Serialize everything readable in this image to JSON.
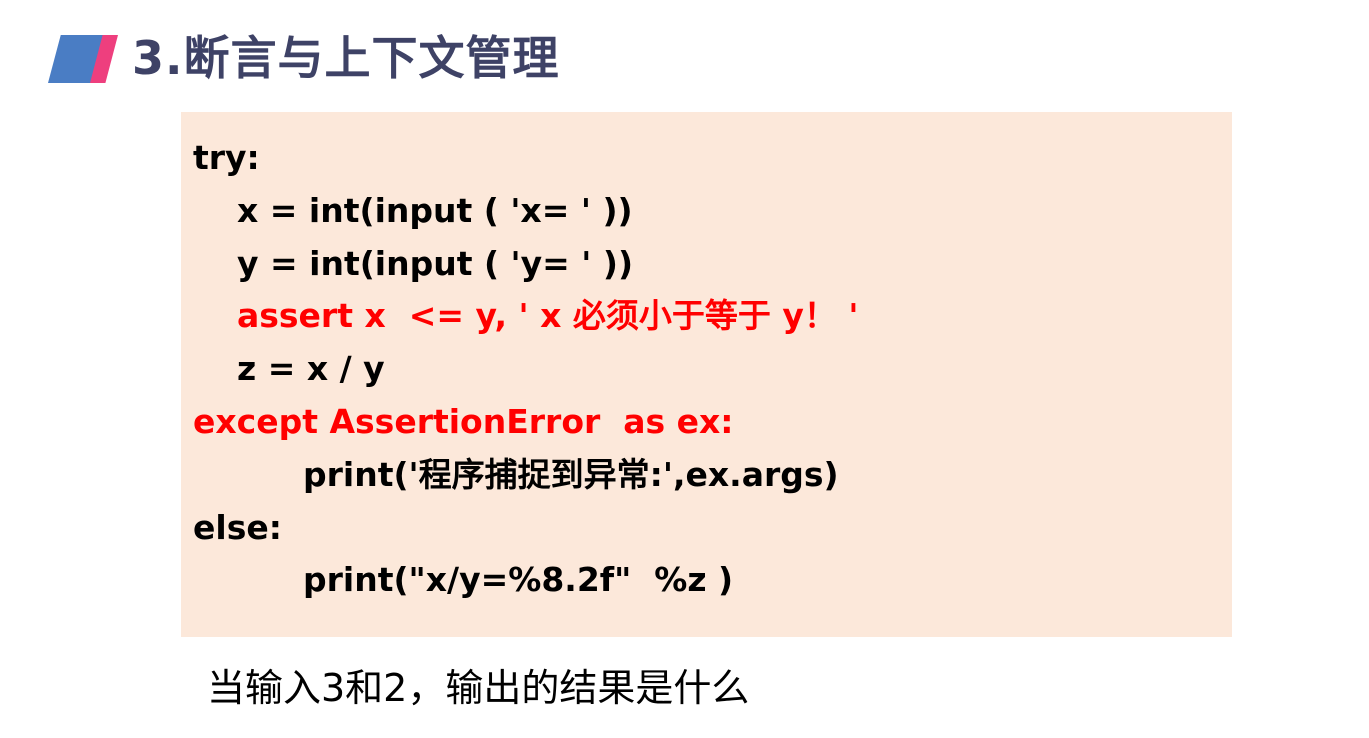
{
  "slide": {
    "title": "3.断言与上下文管理",
    "accent_colors": {
      "marker_blue": "#4a7dc4",
      "marker_pink": "#ee3f7e",
      "title_color": "#3e4266",
      "code_background": "#fce8da",
      "highlight_red": "#ff0000"
    },
    "code_lines": [
      {
        "text": "try:",
        "highlight": false
      },
      {
        "text": "x = int(input ( 'x= ' ))",
        "highlight": false
      },
      {
        "text": "y = int(input ( 'y= ' ))",
        "highlight": false
      },
      {
        "text": "assert x  <= y, ' x 必须小于等于 y！ '",
        "highlight": true
      },
      {
        "text": "z = x / y",
        "highlight": false
      },
      {
        "text": "except AssertionError  as ex:",
        "highlight": true
      },
      {
        "text": "print('程序捕捉到异常:',ex.args)",
        "highlight": false
      },
      {
        "text": "else:",
        "highlight": false
      },
      {
        "text": "print(\"x/y=%8.2f\"  %z )",
        "highlight": false
      }
    ],
    "question": "当输入3和2，输出的结果是什么"
  }
}
